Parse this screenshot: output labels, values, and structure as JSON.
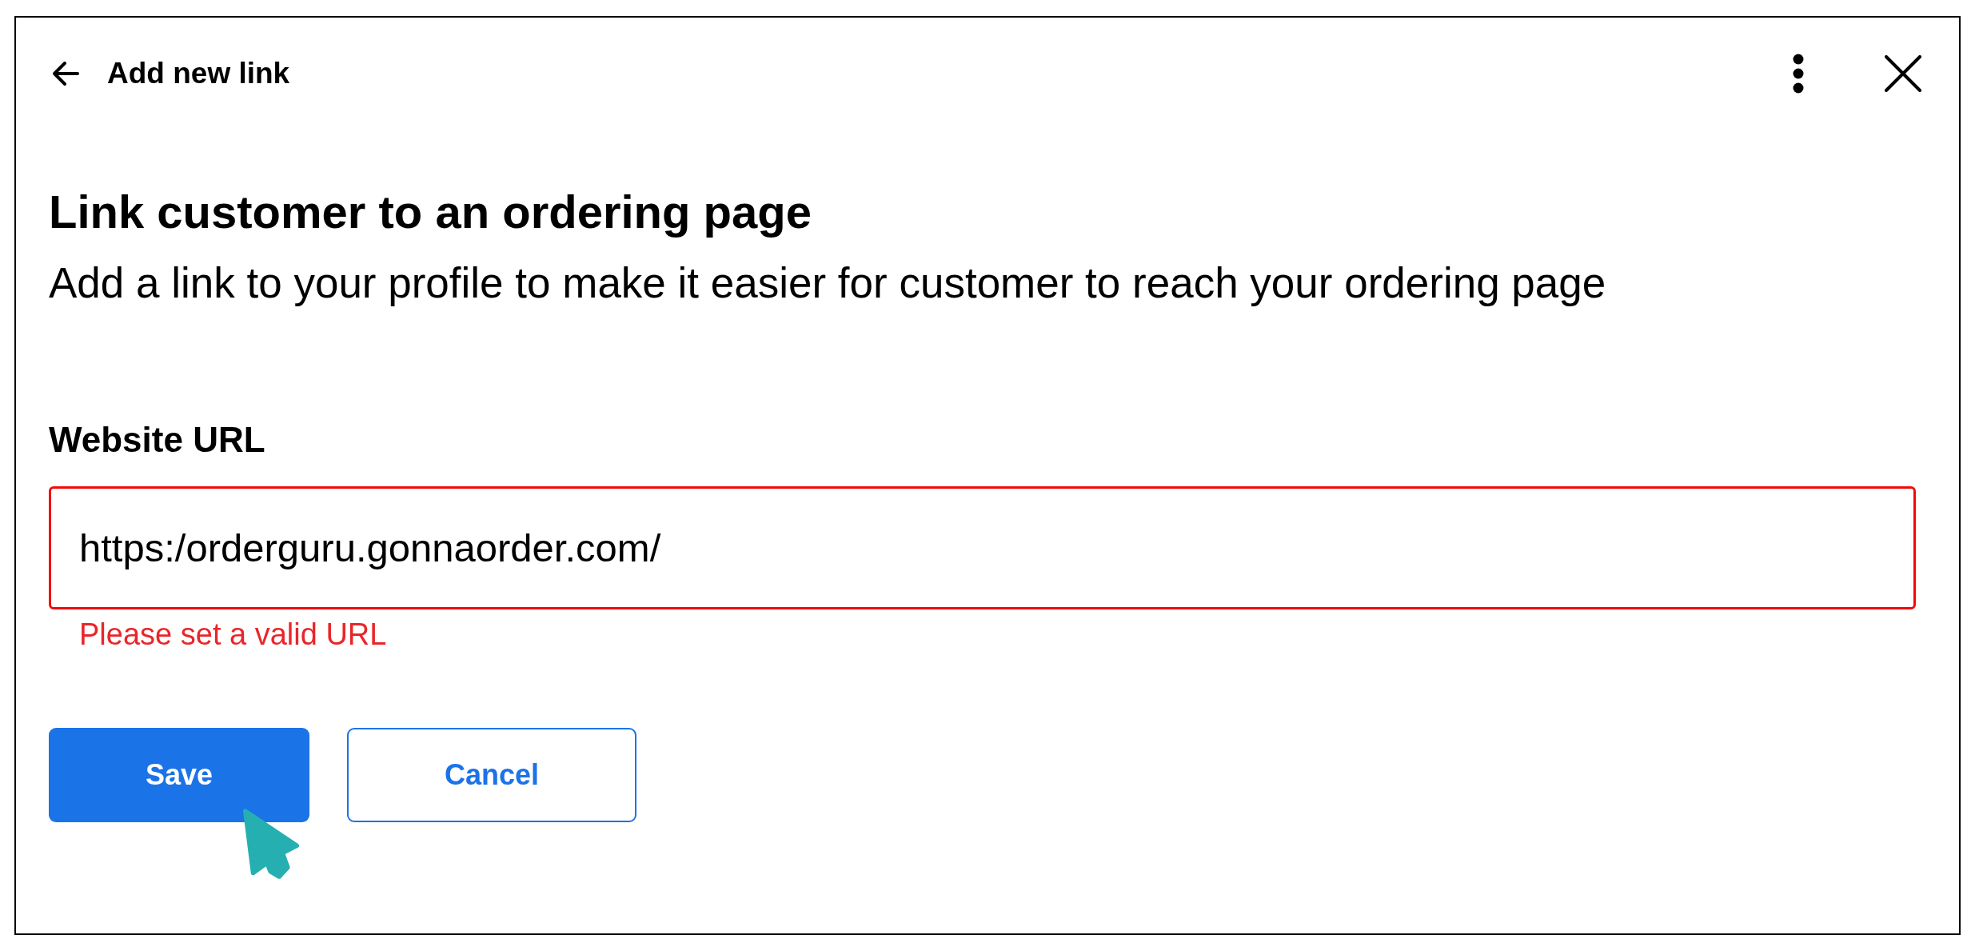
{
  "header": {
    "title": "Add new link"
  },
  "heading": "Link customer to an ordering page",
  "description": "Add a link to your profile to make it easier for customer to reach your ordering page",
  "field": {
    "label": "Website URL",
    "value": "https:/orderguru.gonnaorder.com/",
    "invalid": true,
    "error": "Please set a valid URL"
  },
  "buttons": [
    {
      "label": "Save",
      "kind": "primary"
    },
    {
      "label": "Cancel",
      "kind": "secondary"
    }
  ]
}
